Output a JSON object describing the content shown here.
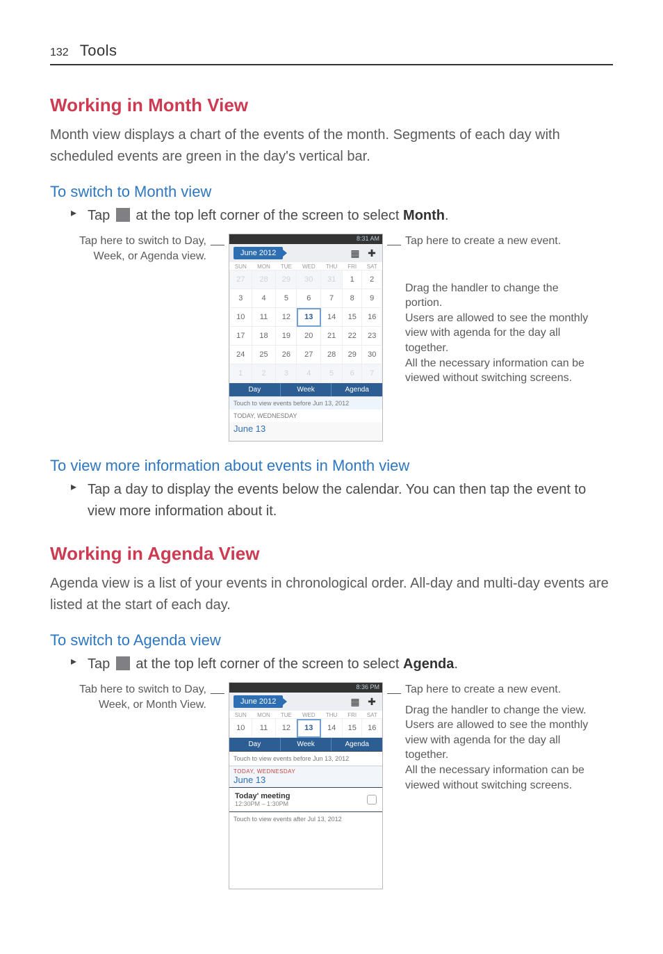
{
  "page": {
    "number": "132",
    "chapter": "Tools"
  },
  "section1": {
    "title": "Working in Month View",
    "intro": "Month view displays a chart of the events of the month. Segments of each day with scheduled events are green in the day's vertical bar.",
    "sub1": {
      "title": "To switch to Month view",
      "bullet_pre": "Tap ",
      "bullet_post": " at the top left corner of the screen to select ",
      "bullet_bold": "Month",
      "bullet_end": "."
    },
    "callout_left": "Tap here to switch to Day, Week, or Agenda view.",
    "callout_right1": "Tap here to create a new event.",
    "callout_right2": "Drag the handler to change the portion.\nUsers are allowed to see the monthly view with agenda for the day all together.\nAll the necessary information can be viewed without switching screens.",
    "sub2": {
      "title": "To view more information about events in Month view",
      "bullet": "Tap a day to display the events below the calendar. You can then tap the event to view more information about it."
    }
  },
  "section2": {
    "title": "Working in Agenda View",
    "intro": "Agenda view is a list of your events in chronological order. All-day and multi-day events are listed at the start of each day.",
    "sub1": {
      "title": "To switch to Agenda view",
      "bullet_pre": "Tap ",
      "bullet_post": " at the top left corner of the screen to select ",
      "bullet_bold": "Agenda",
      "bullet_end": "."
    },
    "callout_left": "Tab here to switch to Day, Week, or Month View.",
    "callout_right1": "Tap here to create a new event.",
    "callout_right2": "Drag the handler to change the view.\nUsers are allowed to see the monthly view with agenda for the day all together.\nAll the necessary information can be viewed without switching screens."
  },
  "phone_month": {
    "status_time": "8:31 AM",
    "title": "June 2012",
    "dow": [
      "SUN",
      "MON",
      "TUE",
      "WED",
      "THU",
      "FRI",
      "SAT"
    ],
    "rows": [
      [
        "27",
        "28",
        "29",
        "30",
        "31",
        "1",
        "2"
      ],
      [
        "3",
        "4",
        "5",
        "6",
        "7",
        "8",
        "9"
      ],
      [
        "10",
        "11",
        "12",
        "13",
        "14",
        "15",
        "16"
      ],
      [
        "17",
        "18",
        "19",
        "20",
        "21",
        "22",
        "23"
      ],
      [
        "24",
        "25",
        "26",
        "27",
        "28",
        "29",
        "30"
      ],
      [
        "1",
        "2",
        "3",
        "4",
        "5",
        "6",
        "7"
      ]
    ],
    "tabs": [
      "Day",
      "Week",
      "Agenda"
    ],
    "agenda_strip": "TODAY, WEDNESDAY",
    "agenda_date": "June 13",
    "touch_hint_top": "Touch to view events before Jun 13, 2012"
  },
  "phone_agenda": {
    "status_time": "8:36 PM",
    "title": "June 2012",
    "dow": [
      "SUN",
      "MON",
      "TUE",
      "WED",
      "THU",
      "FRI",
      "SAT"
    ],
    "week": [
      "10",
      "11",
      "12",
      "13",
      "14",
      "15",
      "16"
    ],
    "tabs": [
      "Day",
      "Week",
      "Agenda"
    ],
    "touch_before": "Touch to view events before Jun 13, 2012",
    "today_label": "TODAY, WEDNESDAY",
    "today_date": "June 13",
    "event_title": "Today' meeting",
    "event_time": "12:30PM – 1:30PM",
    "touch_after": "Touch to view events after Jul 13, 2012"
  }
}
